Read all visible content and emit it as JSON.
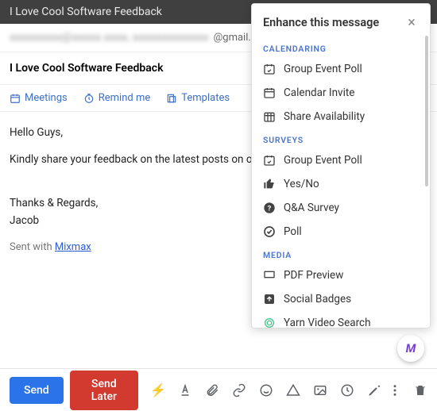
{
  "titlebar": "I Love Cool Software Feedback",
  "recipients_visible": "@gmail.co",
  "subject": "I Love Cool Software Feedback",
  "toolbar": {
    "meetings": "Meetings",
    "remind": "Remind me",
    "templates": "Templates"
  },
  "body": {
    "greeting": "Hello Guys,",
    "line1": "Kindly share your feedback on the latest posts on our w",
    "closing1": "Thanks & Regards,",
    "closing2": "Jacob",
    "sent_prefix": "Sent with ",
    "sent_link": "Mixmax"
  },
  "buttons": {
    "send": "Send",
    "later": "Send Later"
  },
  "panel": {
    "title": "Enhance this message",
    "sections": {
      "calendaring": {
        "label": "CALENDARING",
        "items": [
          "Group Event Poll",
          "Calendar Invite",
          "Share Availability"
        ]
      },
      "surveys": {
        "label": "SURVEYS",
        "items": [
          "Group Event Poll",
          "Yes/No",
          "Q&A Survey",
          "Poll"
        ]
      },
      "media": {
        "label": "MEDIA",
        "items": [
          "PDF Preview",
          "Social Badges",
          "Yarn Video Search"
        ]
      }
    }
  }
}
